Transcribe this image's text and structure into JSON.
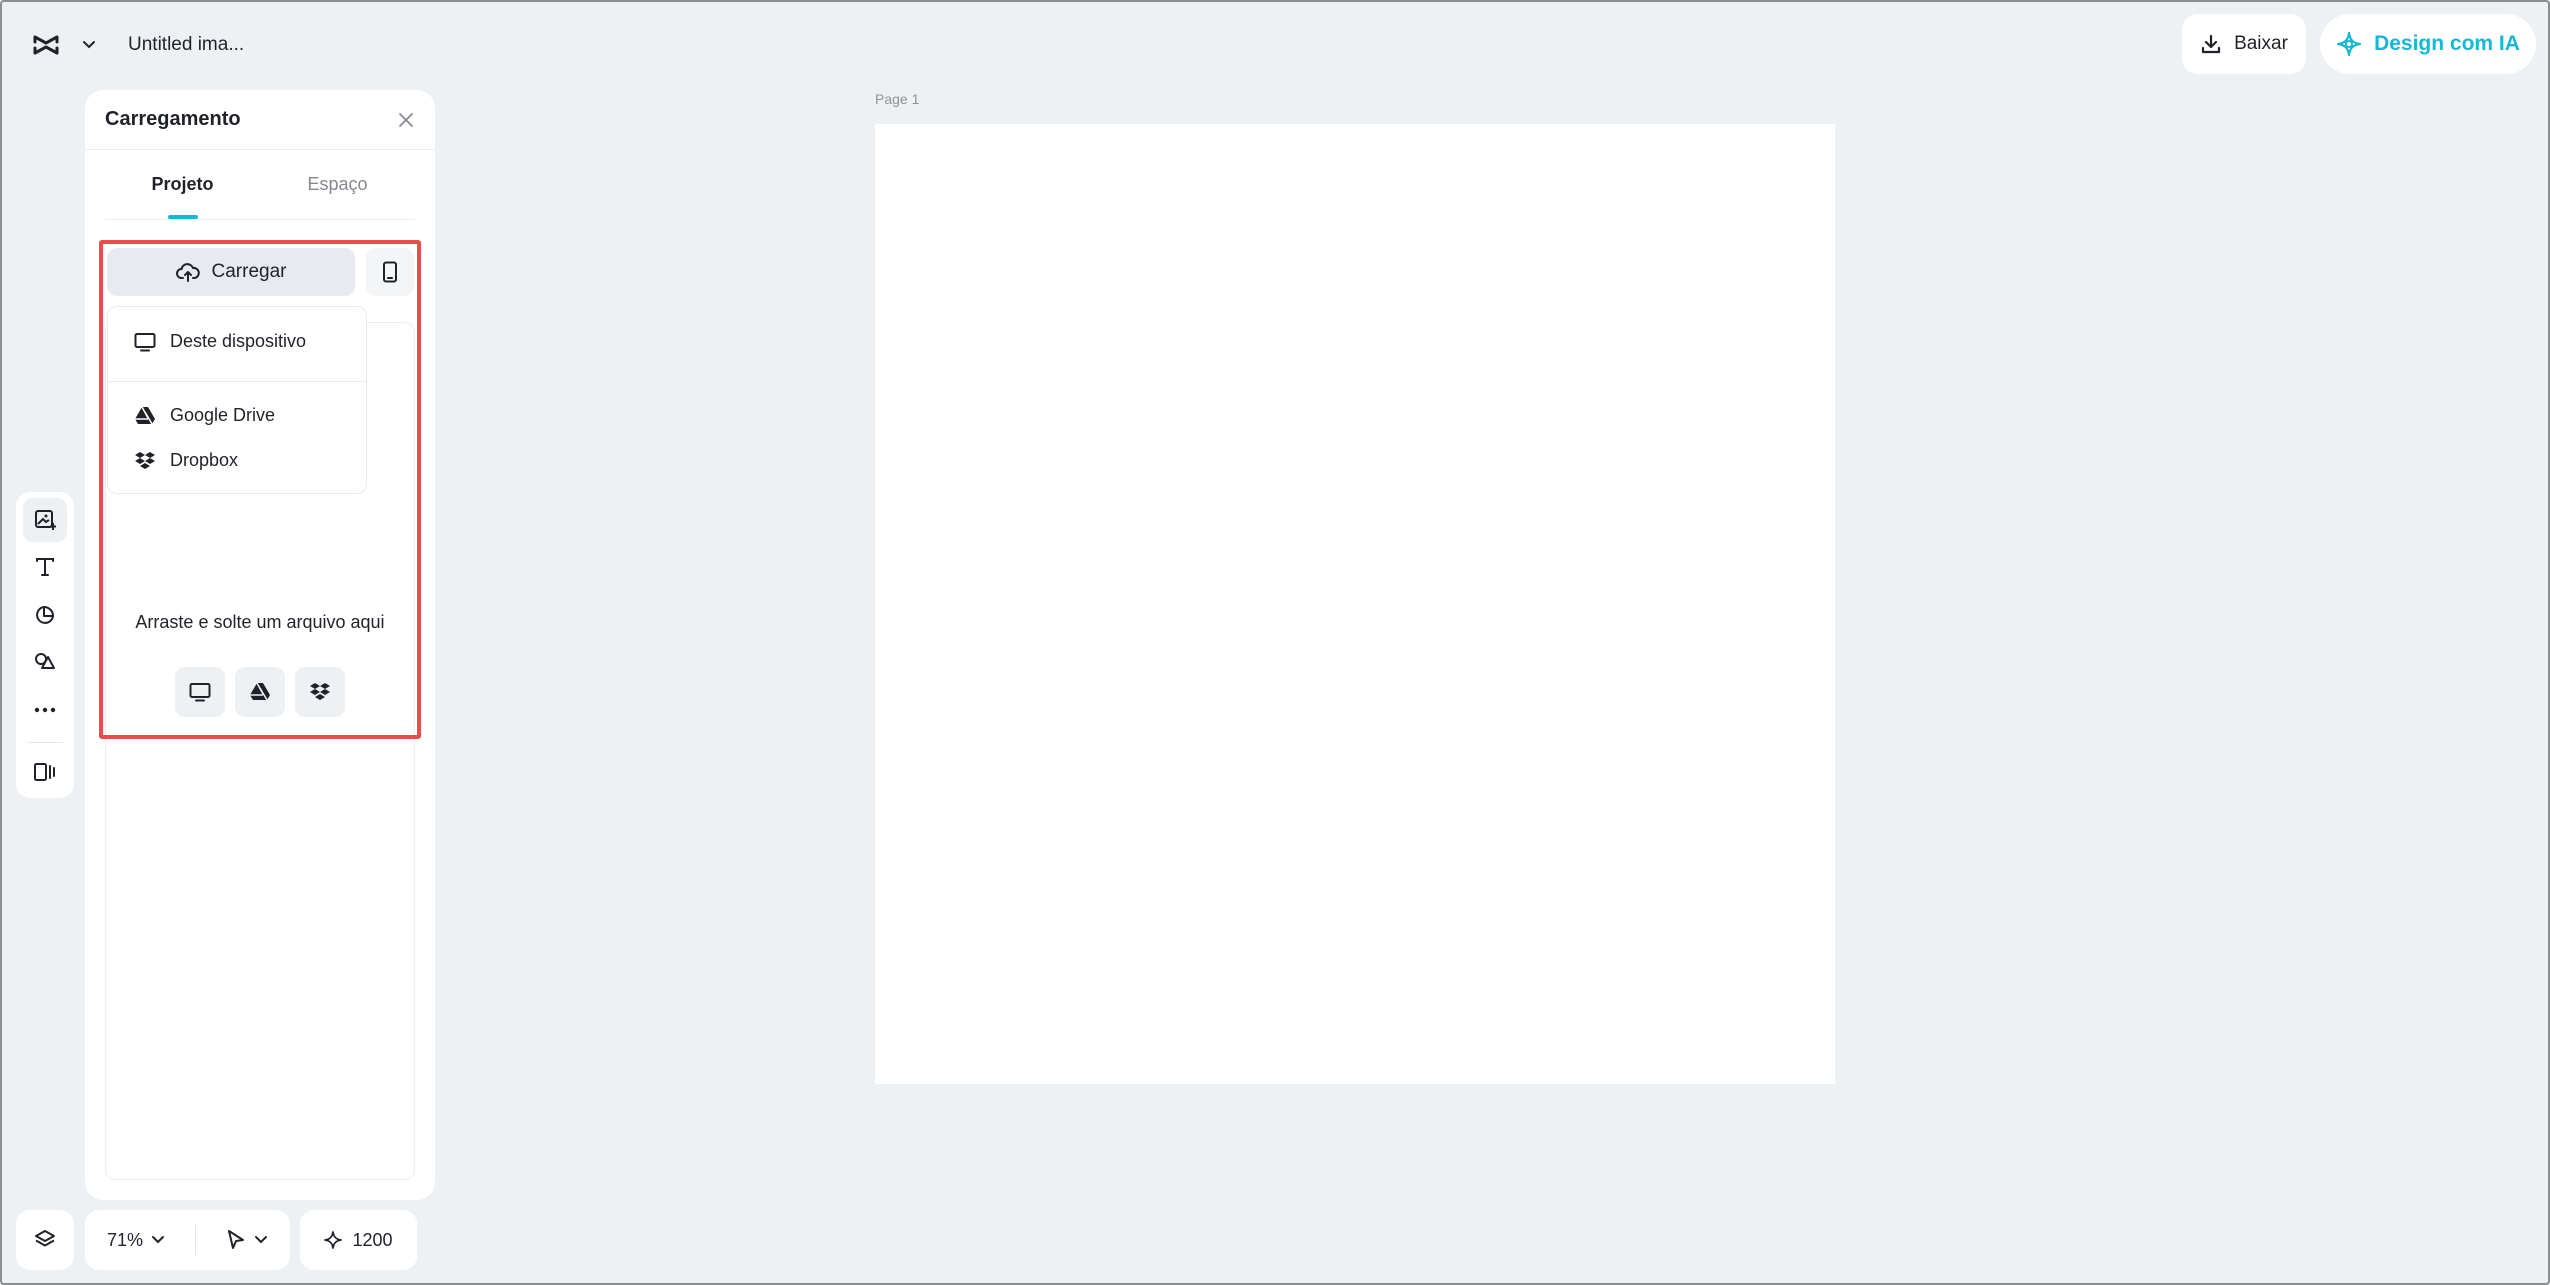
{
  "header": {
    "doc_title": "Untitled ima...",
    "download_label": "Baixar",
    "ai_design_label": "Design com IA"
  },
  "upload_panel": {
    "title": "Carregamento",
    "tabs": [
      {
        "label": "Projeto",
        "active": true
      },
      {
        "label": "Espaço",
        "active": false
      }
    ],
    "upload_button_label": "Carregar",
    "menu": {
      "device_label": "Deste dispositivo",
      "google_drive_label": "Google Drive",
      "dropbox_label": "Dropbox"
    },
    "drop_text": "Arraste e solte um arquivo aqui"
  },
  "canvas": {
    "page_label": "Page 1"
  },
  "bottom_bar": {
    "zoom": "71%",
    "credits": "1200"
  },
  "colors": {
    "accent": "#16b8d6",
    "highlight": "#ea4b4b",
    "background": "#eef1f4"
  }
}
